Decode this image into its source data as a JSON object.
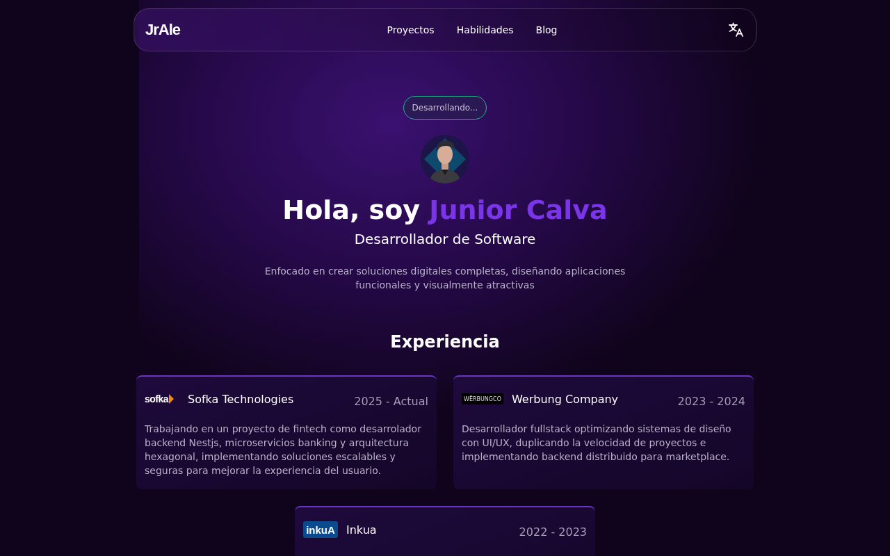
{
  "nav": {
    "logo": "JrAle",
    "links": [
      {
        "label": "Proyectos"
      },
      {
        "label": "Habilidades"
      },
      {
        "label": "Blog"
      }
    ]
  },
  "hero": {
    "badge": "Desarrollando...",
    "greeting": "Hola, soy",
    "name": "Junior Calva",
    "role": "Desarrollador de Software",
    "summary": "Enfocado en crear soluciones digitales completas, diseñando aplicaciones funcionales y visualmente atractivas"
  },
  "experience": {
    "title": "Experiencia",
    "items": [
      {
        "logo": {
          "kind": "sofka",
          "text": "sofka"
        },
        "company": "Sofka Technologies",
        "period": "2025 - Actual",
        "description": "Trabajando en un proyecto de fintech como desarrolador backend Nestjs, microservicios banking y arquitectura hexagonal, implementando soluciones escalables y seguras para mejorar la experiencia del usuario."
      },
      {
        "logo": {
          "kind": "werbung",
          "text": "WËRBUNGCO"
        },
        "company": "Werbung Company",
        "period": "2023 - 2024",
        "description": "Desarrollador fullstack optimizando sistemas de diseño con UI/UX, duplicando la velocidad de proyectos e implementando backend distribuido para marketplace."
      },
      {
        "logo": {
          "kind": "inkua",
          "text": "inkuA"
        },
        "company": "Inkua",
        "period": "2022 - 2023"
      }
    ]
  }
}
